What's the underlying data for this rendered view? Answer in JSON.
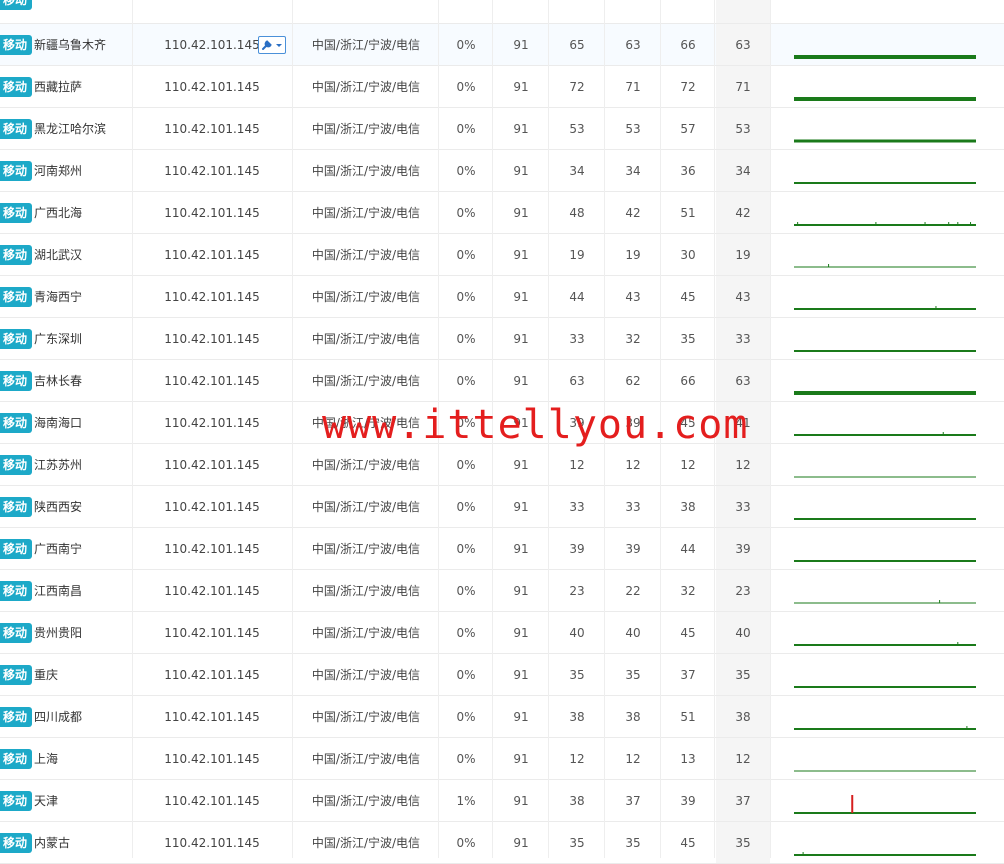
{
  "badge_label": "移动",
  "watermark": "www.ittellyou.com",
  "colors": {
    "badge": "#1da9c8",
    "spark_ok": "#1a7a1a",
    "spark_loss": "#d61f1f",
    "watermark": "#e41e1e"
  },
  "rows": [
    {
      "city": "新疆乌鲁木齐",
      "ip": "110.42.101.145",
      "loc": "中国/浙江/宁波/电信",
      "loss": "0%",
      "sent": "91",
      "last": "65",
      "best": "63",
      "worst": "66",
      "avg": "63",
      "tool": true,
      "spark": {
        "weight": 4,
        "spikes": []
      }
    },
    {
      "city": "西藏拉萨",
      "ip": "110.42.101.145",
      "loc": "中国/浙江/宁波/电信",
      "loss": "0%",
      "sent": "91",
      "last": "72",
      "best": "71",
      "worst": "72",
      "avg": "71",
      "spark": {
        "weight": 4,
        "spikes": []
      }
    },
    {
      "city": "黑龙江哈尔滨",
      "ip": "110.42.101.145",
      "loc": "中国/浙江/宁波/电信",
      "loss": "0%",
      "sent": "91",
      "last": "53",
      "best": "53",
      "worst": "57",
      "avg": "53",
      "spark": {
        "weight": 3,
        "spikes": []
      }
    },
    {
      "city": "河南郑州",
      "ip": "110.42.101.145",
      "loc": "中国/浙江/宁波/电信",
      "loss": "0%",
      "sent": "91",
      "last": "34",
      "best": "34",
      "worst": "36",
      "avg": "34",
      "spark": {
        "weight": 2,
        "spikes": []
      }
    },
    {
      "city": "广西北海",
      "ip": "110.42.101.145",
      "loc": "中国/浙江/宁波/电信",
      "loss": "0%",
      "sent": "91",
      "last": "48",
      "best": "42",
      "worst": "51",
      "avg": "42",
      "spark": {
        "weight": 2,
        "spikes": [
          0.02,
          0.45,
          0.72,
          0.85,
          0.9,
          0.97
        ]
      }
    },
    {
      "city": "湖北武汉",
      "ip": "110.42.101.145",
      "loc": "中国/浙江/宁波/电信",
      "loss": "0%",
      "sent": "91",
      "last": "19",
      "best": "19",
      "worst": "30",
      "avg": "19",
      "spark": {
        "weight": 1,
        "spikes": [
          0.19
        ]
      }
    },
    {
      "city": "青海西宁",
      "ip": "110.42.101.145",
      "loc": "中国/浙江/宁波/电信",
      "loss": "0%",
      "sent": "91",
      "last": "44",
      "best": "43",
      "worst": "45",
      "avg": "43",
      "spark": {
        "weight": 2,
        "spikes": [
          0.78
        ]
      }
    },
    {
      "city": "广东深圳",
      "ip": "110.42.101.145",
      "loc": "中国/浙江/宁波/电信",
      "loss": "0%",
      "sent": "91",
      "last": "33",
      "best": "32",
      "worst": "35",
      "avg": "33",
      "spark": {
        "weight": 2,
        "spikes": []
      }
    },
    {
      "city": "吉林长春",
      "ip": "110.42.101.145",
      "loc": "中国/浙江/宁波/电信",
      "loss": "0%",
      "sent": "91",
      "last": "63",
      "best": "62",
      "worst": "66",
      "avg": "63",
      "spark": {
        "weight": 4,
        "spikes": []
      }
    },
    {
      "city": "海南海口",
      "ip": "110.42.101.145",
      "loc": "中国/浙江/宁波/电信",
      "loss": "0%",
      "sent": "91",
      "last": "39",
      "best": "39",
      "worst": "45",
      "avg": "41",
      "spark": {
        "weight": 2,
        "spikes": [
          0.82
        ]
      }
    },
    {
      "city": "江苏苏州",
      "ip": "110.42.101.145",
      "loc": "中国/浙江/宁波/电信",
      "loss": "0%",
      "sent": "91",
      "last": "12",
      "best": "12",
      "worst": "12",
      "avg": "12",
      "spark": {
        "weight": 1,
        "spikes": []
      }
    },
    {
      "city": "陕西西安",
      "ip": "110.42.101.145",
      "loc": "中国/浙江/宁波/电信",
      "loss": "0%",
      "sent": "91",
      "last": "33",
      "best": "33",
      "worst": "38",
      "avg": "33",
      "spark": {
        "weight": 2,
        "spikes": []
      }
    },
    {
      "city": "广西南宁",
      "ip": "110.42.101.145",
      "loc": "中国/浙江/宁波/电信",
      "loss": "0%",
      "sent": "91",
      "last": "39",
      "best": "39",
      "worst": "44",
      "avg": "39",
      "spark": {
        "weight": 2,
        "spikes": []
      }
    },
    {
      "city": "江西南昌",
      "ip": "110.42.101.145",
      "loc": "中国/浙江/宁波/电信",
      "loss": "0%",
      "sent": "91",
      "last": "23",
      "best": "22",
      "worst": "32",
      "avg": "23",
      "spark": {
        "weight": 1,
        "spikes": [
          0.8
        ]
      }
    },
    {
      "city": "贵州贵阳",
      "ip": "110.42.101.145",
      "loc": "中国/浙江/宁波/电信",
      "loss": "0%",
      "sent": "91",
      "last": "40",
      "best": "40",
      "worst": "45",
      "avg": "40",
      "spark": {
        "weight": 2,
        "spikes": [
          0.9
        ]
      }
    },
    {
      "city": "重庆",
      "ip": "110.42.101.145",
      "loc": "中国/浙江/宁波/电信",
      "loss": "0%",
      "sent": "91",
      "last": "35",
      "best": "35",
      "worst": "37",
      "avg": "35",
      "spark": {
        "weight": 2,
        "spikes": []
      }
    },
    {
      "city": "四川成都",
      "ip": "110.42.101.145",
      "loc": "中国/浙江/宁波/电信",
      "loss": "0%",
      "sent": "91",
      "last": "38",
      "best": "38",
      "worst": "51",
      "avg": "38",
      "spark": {
        "weight": 2,
        "spikes": [
          0.95
        ]
      }
    },
    {
      "city": "上海",
      "ip": "110.42.101.145",
      "loc": "中国/浙江/宁波/电信",
      "loss": "0%",
      "sent": "91",
      "last": "12",
      "best": "12",
      "worst": "13",
      "avg": "12",
      "spark": {
        "weight": 1,
        "spikes": []
      }
    },
    {
      "city": "天津",
      "ip": "110.42.101.145",
      "loc": "中国/浙江/宁波/电信",
      "loss": "1%",
      "sent": "91",
      "last": "38",
      "best": "37",
      "worst": "39",
      "avg": "37",
      "spark": {
        "weight": 2,
        "spikes": [],
        "loss_at": 0.32
      }
    },
    {
      "city": "内蒙古",
      "ip": "110.42.101.145",
      "loc": "中国/浙江/宁波/电信",
      "loss": "0%",
      "sent": "91",
      "last": "35",
      "best": "35",
      "worst": "45",
      "avg": "35",
      "spark": {
        "weight": 2,
        "spikes": [
          0.05
        ]
      }
    }
  ]
}
